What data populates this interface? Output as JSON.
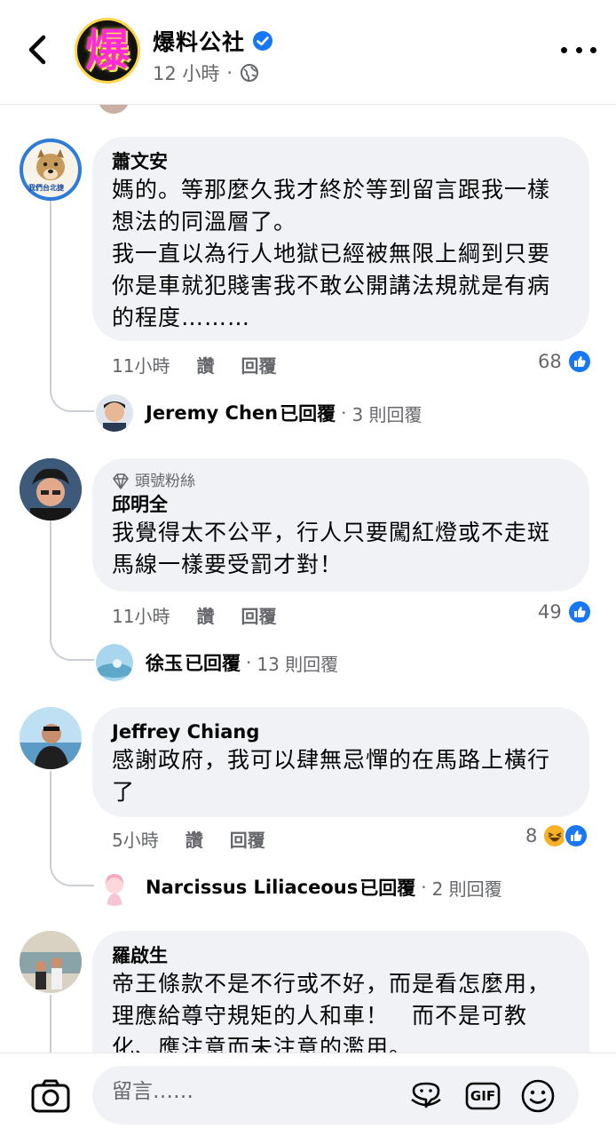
{
  "header": {
    "avatar_text": "爆",
    "page_name": "爆料公社",
    "post_time": "12 小時",
    "separator": "·"
  },
  "comments": [
    {
      "author": "蕭文安",
      "avatar_caption": "我們台北捷",
      "lines": [
        "媽的。等那麼久我才終於等到留言跟我一樣",
        "想法的同溫層了。",
        "我一直以為行人地獄已經被無限上綱到只要",
        "你是車就犯賤害我不敢公開講法規就是有病",
        "的程度………"
      ],
      "time": "11小時",
      "like_label": "讚",
      "reply_label": "回覆",
      "reaction_count": "68",
      "reply": {
        "name": "Jeremy Chen",
        "verb": "已回覆",
        "dot": "·",
        "count": "3 則回覆"
      }
    },
    {
      "badge": "頭號粉絲",
      "author": "邱明全",
      "lines": [
        "我覺得太不公平，行人只要闖紅燈或不走斑",
        "馬線一樣要受罰才對！"
      ],
      "time": "11小時",
      "like_label": "讚",
      "reply_label": "回覆",
      "reaction_count": "49",
      "reply": {
        "name": "徐玉",
        "verb": "已回覆",
        "dot": "·",
        "count": "13 則回覆"
      }
    },
    {
      "author": "Jeffrey Chiang",
      "lines": [
        "感謝政府，我可以肆無忌憚的在馬路上橫行",
        "了"
      ],
      "time": "5小時",
      "like_label": "讚",
      "reply_label": "回覆",
      "reaction_count": "8",
      "reply": {
        "name": "Narcissus Liliaceous",
        "verb": "已回覆",
        "dot": "·",
        "count": "2 則回覆"
      }
    },
    {
      "author": "羅啟生",
      "lines": [
        "帝王條款不是不行或不好，而是看怎麼用，",
        "理應給尊守規矩的人和車！　而不是可教",
        "化、應注意而未注意的濫用。"
      ]
    }
  ],
  "composer": {
    "placeholder": "留言……",
    "gif_label": "GIF"
  },
  "colors": {
    "accent": "#1877f2",
    "bubble": "#f0f2f5",
    "meta_text": "#65676b",
    "haha": "#f7b125"
  },
  "icons": [
    "back-arrow-icon",
    "verified-badge-icon",
    "globe-icon",
    "more-icon",
    "diamond-icon",
    "like-icon",
    "haha-icon",
    "camera-icon",
    "sticker-icon",
    "gif-icon",
    "emoji-icon"
  ]
}
